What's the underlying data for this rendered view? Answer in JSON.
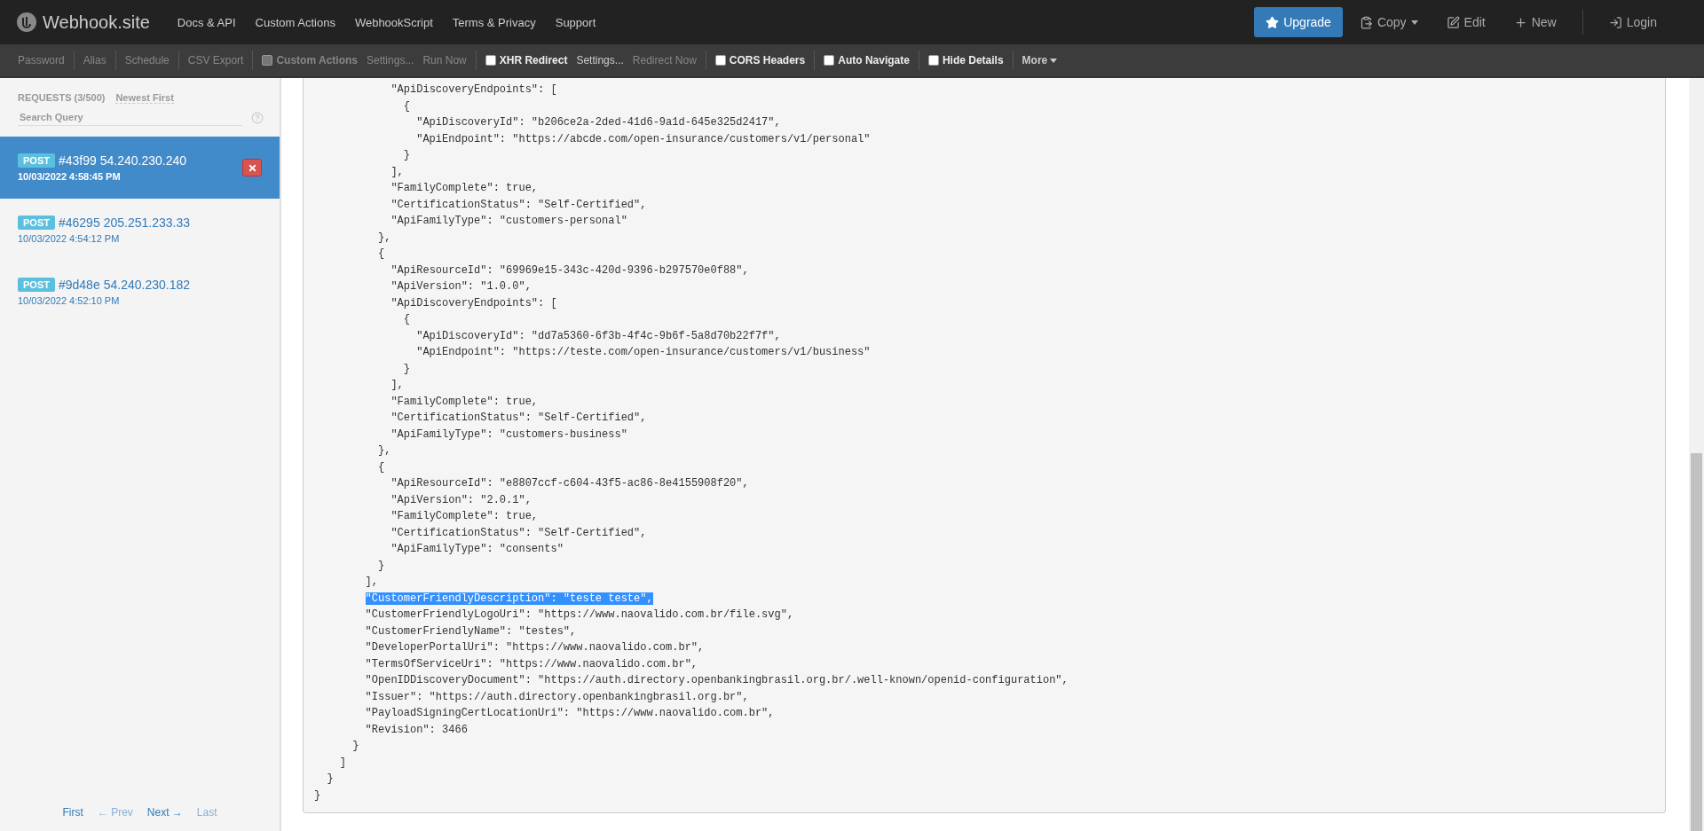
{
  "navbar": {
    "brand": "Webhook.site",
    "links": [
      "Docs & API",
      "Custom Actions",
      "WebhookScript",
      "Terms & Privacy",
      "Support"
    ],
    "actions": [
      {
        "label": "Upgrade",
        "kind": "primary"
      },
      {
        "label": "Copy",
        "kind": "dropdown"
      },
      {
        "label": "Edit",
        "kind": "plain"
      },
      {
        "label": "New",
        "kind": "plain"
      },
      {
        "label": "Login",
        "kind": "plain"
      }
    ]
  },
  "toolbar": {
    "groups": [
      [
        {
          "label": "Password",
          "kind": "link",
          "disabled": true
        }
      ],
      [
        {
          "label": "Alias",
          "kind": "link",
          "disabled": true
        }
      ],
      [
        {
          "label": "Schedule",
          "kind": "link",
          "disabled": true
        }
      ],
      [
        {
          "label": "CSV Export",
          "kind": "link",
          "disabled": true
        }
      ],
      [
        {
          "label": "Custom Actions",
          "kind": "checkbox",
          "checked": false,
          "disabled": true
        },
        {
          "label": "Settings...",
          "kind": "link",
          "disabled": true
        },
        {
          "label": "Run Now",
          "kind": "link",
          "disabled": true
        }
      ],
      [
        {
          "label": "XHR Redirect",
          "kind": "checkbox",
          "checked": false,
          "disabled": false
        },
        {
          "label": "Settings...",
          "kind": "link",
          "disabled": false
        },
        {
          "label": "Redirect Now",
          "kind": "link",
          "disabled": true
        }
      ],
      [
        {
          "label": "CORS Headers",
          "kind": "checkbox",
          "checked": false,
          "disabled": false
        }
      ],
      [
        {
          "label": "Auto Navigate",
          "kind": "checkbox",
          "checked": false,
          "disabled": false
        }
      ],
      [
        {
          "label": "Hide Details",
          "kind": "checkbox",
          "checked": false,
          "disabled": false
        }
      ],
      [
        {
          "label": "More",
          "kind": "dropdown",
          "disabled": false
        }
      ]
    ]
  },
  "sidebar": {
    "title": "REQUESTS (3/500)",
    "sort": "Newest First",
    "search": {
      "placeholder": "Search Query"
    },
    "requests": [
      {
        "method": "POST",
        "id": "#43f99",
        "ip": "54.240.230.240",
        "time": "10/03/2022 4:58:45 PM",
        "selected": true
      },
      {
        "method": "POST",
        "id": "#46295",
        "ip": "205.251.233.33",
        "time": "10/03/2022 4:54:12 PM",
        "selected": false
      },
      {
        "method": "POST",
        "id": "#9d48e",
        "ip": "54.240.230.182",
        "time": "10/03/2022 4:52:10 PM",
        "selected": false
      }
    ],
    "pagination": [
      {
        "label": "First",
        "disabled": false
      },
      {
        "label": "← Prev",
        "disabled": true
      },
      {
        "label": "Next →",
        "disabled": false
      },
      {
        "label": "Last",
        "disabled": true
      }
    ]
  },
  "body": {
    "lines": [
      {
        "text": "            \"ApiDiscoveryEndpoints\": [",
        "selected": false
      },
      {
        "text": "              {",
        "selected": false
      },
      {
        "text": "                \"ApiDiscoveryId\": \"b206ce2a-2ded-41d6-9a1d-645e325d2417\",",
        "selected": false
      },
      {
        "text": "                \"ApiEndpoint\": \"https://abcde.com/open-insurance/customers/v1/personal\"",
        "selected": false
      },
      {
        "text": "              }",
        "selected": false
      },
      {
        "text": "            ],",
        "selected": false
      },
      {
        "text": "            \"FamilyComplete\": true,",
        "selected": false
      },
      {
        "text": "            \"CertificationStatus\": \"Self-Certified\",",
        "selected": false
      },
      {
        "text": "            \"ApiFamilyType\": \"customers-personal\"",
        "selected": false
      },
      {
        "text": "          },",
        "selected": false
      },
      {
        "text": "          {",
        "selected": false
      },
      {
        "text": "            \"ApiResourceId\": \"69969e15-343c-420d-9396-b297570e0f88\",",
        "selected": false
      },
      {
        "text": "            \"ApiVersion\": \"1.0.0\",",
        "selected": false
      },
      {
        "text": "            \"ApiDiscoveryEndpoints\": [",
        "selected": false
      },
      {
        "text": "              {",
        "selected": false
      },
      {
        "text": "                \"ApiDiscoveryId\": \"dd7a5360-6f3b-4f4c-9b6f-5a8d70b22f7f\",",
        "selected": false
      },
      {
        "text": "                \"ApiEndpoint\": \"https://teste.com/open-insurance/customers/v1/business\"",
        "selected": false
      },
      {
        "text": "              }",
        "selected": false
      },
      {
        "text": "            ],",
        "selected": false
      },
      {
        "text": "            \"FamilyComplete\": true,",
        "selected": false
      },
      {
        "text": "            \"CertificationStatus\": \"Self-Certified\",",
        "selected": false
      },
      {
        "text": "            \"ApiFamilyType\": \"customers-business\"",
        "selected": false
      },
      {
        "text": "          },",
        "selected": false
      },
      {
        "text": "          {",
        "selected": false
      },
      {
        "text": "            \"ApiResourceId\": \"e8807ccf-c604-43f5-ac86-8e4155908f20\",",
        "selected": false
      },
      {
        "text": "            \"ApiVersion\": \"2.0.1\",",
        "selected": false
      },
      {
        "text": "            \"FamilyComplete\": true,",
        "selected": false
      },
      {
        "text": "            \"CertificationStatus\": \"Self-Certified\",",
        "selected": false
      },
      {
        "text": "            \"ApiFamilyType\": \"consents\"",
        "selected": false
      },
      {
        "text": "          }",
        "selected": false
      },
      {
        "text": "        ],",
        "selected": false
      },
      {
        "text": "        \"CustomerFriendlyDescription\": \"teste teste\",",
        "selected": true
      },
      {
        "text": "        \"CustomerFriendlyLogoUri\": \"https://www.naovalido.com.br/file.svg\",",
        "selected": false
      },
      {
        "text": "        \"CustomerFriendlyName\": \"testes\",",
        "selected": false
      },
      {
        "text": "        \"DeveloperPortalUri\": \"https://www.naovalido.com.br\",",
        "selected": false
      },
      {
        "text": "        \"TermsOfServiceUri\": \"https://www.naovalido.com.br\",",
        "selected": false
      },
      {
        "text": "        \"OpenIDDiscoveryDocument\": \"https://auth.directory.openbankingbrasil.org.br/.well-known/openid-configuration\",",
        "selected": false
      },
      {
        "text": "        \"Issuer\": \"https://auth.directory.openbankingbrasil.org.br\",",
        "selected": false
      },
      {
        "text": "        \"PayloadSigningCertLocationUri\": \"https://www.naovalido.com.br\",",
        "selected": false
      },
      {
        "text": "        \"Revision\": 3466",
        "selected": false
      },
      {
        "text": "      }",
        "selected": false
      },
      {
        "text": "    ]",
        "selected": false
      },
      {
        "text": "  }",
        "selected": false
      },
      {
        "text": "}",
        "selected": false
      }
    ]
  }
}
